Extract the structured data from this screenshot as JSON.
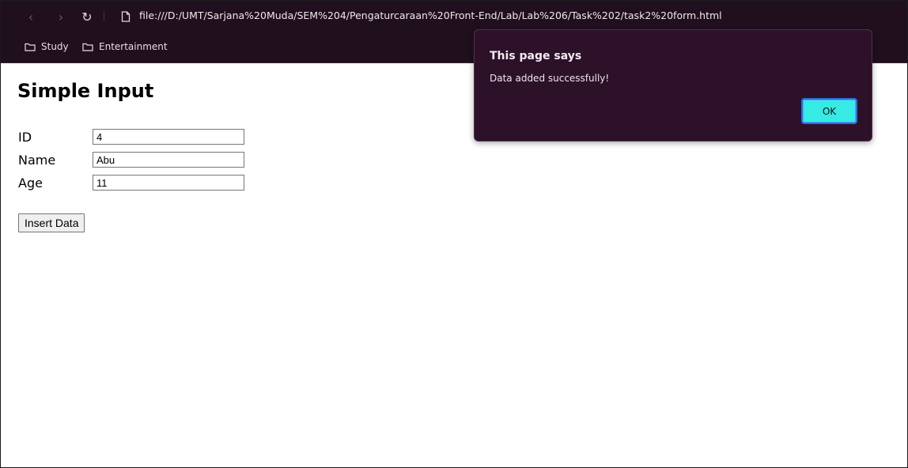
{
  "browser": {
    "back_icon": "‹",
    "forward_icon": "›",
    "reload_icon": "↻",
    "page_icon": "🗋",
    "url": "file:///D:/UMT/Sarjana%20Muda/SEM%204/Pengaturcaraan%20Front-End/Lab/Lab%206/Task%202/task2%20form.html",
    "bookmarks": [
      {
        "label": "Study",
        "icon": "folder-icon"
      },
      {
        "label": "Entertainment",
        "icon": "folder-icon"
      }
    ]
  },
  "page": {
    "title": "Simple Input",
    "fields": [
      {
        "label": "ID",
        "value": "4"
      },
      {
        "label": "Name",
        "value": "Abu"
      },
      {
        "label": "Age",
        "value": "11"
      }
    ],
    "insert_button_label": "Insert Data"
  },
  "dialog": {
    "title": "This page says",
    "message": "Data added successfully!",
    "ok_label": "OK"
  },
  "colors": {
    "chrome_bg": "#200f1d",
    "dialog_bg": "#2c1129",
    "ok_button": "#35ebe3",
    "ok_focus_ring": "#2a6fd8"
  }
}
